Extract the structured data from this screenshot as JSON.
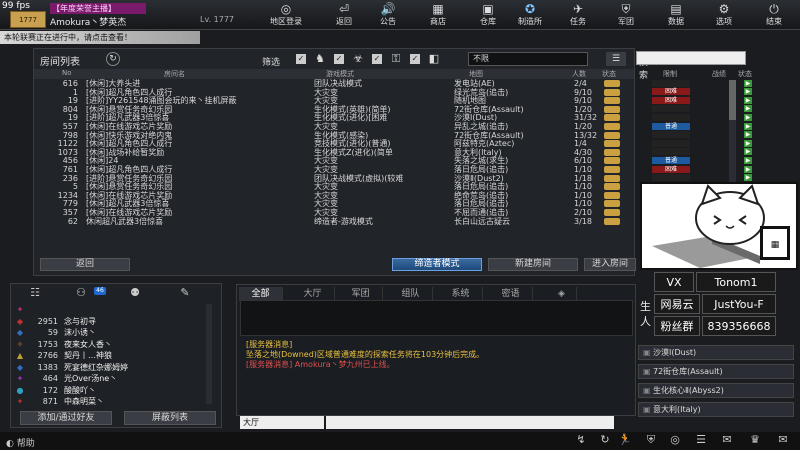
{
  "fps": "99 fps",
  "player": {
    "title_badge": "【年度荣誉主播】",
    "name": "Amokura丶梦英杰",
    "level": "Lv. 1777",
    "logo_text": "1777"
  },
  "nav": [
    {
      "label": "地区登录",
      "icon": "globe-icon",
      "glyph": "◎"
    },
    {
      "label": "返回",
      "icon": "back-icon",
      "glyph": "⏎"
    },
    {
      "label": "公告",
      "icon": "announcement-icon",
      "glyph": "🔊"
    },
    {
      "label": "商店",
      "icon": "shop-icon",
      "glyph": "▦"
    },
    {
      "label": "仓库",
      "icon": "warehouse-icon",
      "glyph": "▣"
    },
    {
      "label": "制造所",
      "icon": "factory-icon",
      "glyph": "✪"
    },
    {
      "label": "任务",
      "icon": "mission-icon",
      "glyph": "✈"
    },
    {
      "label": "军团",
      "icon": "clan-icon",
      "glyph": "⛨"
    },
    {
      "label": "数据",
      "icon": "stats-icon",
      "glyph": "▤"
    },
    {
      "label": "选项",
      "icon": "gear-icon",
      "glyph": "⚙"
    },
    {
      "label": "结束",
      "icon": "power-icon",
      "glyph": "⏻"
    }
  ],
  "banner": "本轮联赛正在进行中，请点击查看！",
  "room_list": {
    "title": "房间列表",
    "filter_label": "筛选",
    "limit_value": "不限",
    "search_label": "搜索",
    "search_value": "",
    "headers": [
      "No",
      "房间名",
      "游戏模式",
      "地图",
      "人数",
      "状态",
      "限制",
      "战绩",
      "状态"
    ],
    "rows": [
      {
        "no": "616",
        "name": "[休闲]大养头进",
        "mode": "团队决战模式",
        "map": "发电站(AE)",
        "count": "2/4",
        "rank": "",
        "rank_color": "#222"
      },
      {
        "no": "1",
        "name": "[休闲]超凡角色四人成行",
        "mode": "大灾变",
        "map": "绿光荒岛(追击)",
        "count": "9/10",
        "rank": "困难",
        "rank_color": "#8a1a1a"
      },
      {
        "no": "19",
        "name": "[进阶]YY261548涌图会玩的来丶挂机屏蔽",
        "mode": "大灾变",
        "map": "随机地图",
        "count": "9/10",
        "rank": "困难",
        "rank_color": "#8a1a1a"
      },
      {
        "no": "804",
        "name": "[休闲]悬赏任务奇幻乐园",
        "mode": "生化模式(英雄)(简单)",
        "map": "72街仓库(Assault)",
        "count": "1/20",
        "rank": "",
        "rank_color": "#222"
      },
      {
        "no": "19",
        "name": "[进阶]超凡武器3倍惊喜",
        "mode": "生化模式(进化)[困难",
        "map": "沙漠Ⅰ(Dust)",
        "count": "31/32",
        "rank": "",
        "rank_color": "#222"
      },
      {
        "no": "557",
        "name": "[休闲]在线游戏芯片奖励",
        "mode": "大灾变",
        "map": "异乱之城(追击)",
        "count": "1/20",
        "rank": "普通",
        "rank_color": "#1e5aa0"
      },
      {
        "no": "798",
        "name": "[休闲]快乐游戏对绝内鬼",
        "mode": "生化模式(感染)",
        "map": "72街仓库(Assault)",
        "count": "13/32",
        "rank": "",
        "rank_color": "#222"
      },
      {
        "no": "1122",
        "name": "[休闲]超凡角色四人成行",
        "mode": "竞技模式(进化)(普通)",
        "map": "阿兹特克(Aztec)",
        "count": "1/4",
        "rank": "",
        "rank_color": "#222"
      },
      {
        "no": "1073",
        "name": "[休闲]战场补给暂奖励",
        "mode": "生化模式Z(进化)(简单",
        "map": "意大利(Italy)",
        "count": "4/30",
        "rank": "",
        "rank_color": "#222"
      },
      {
        "no": "456",
        "name": "[休闲]24",
        "mode": "大灾变",
        "map": "失落之城(求生)",
        "count": "6/10",
        "rank": "普通",
        "rank_color": "#1e5aa0"
      },
      {
        "no": "761",
        "name": "[休闲]超凡角色四人成行",
        "mode": "大灾变",
        "map": "落日危局(追击)",
        "count": "1/10",
        "rank": "困难",
        "rank_color": "#8a1a1a"
      },
      {
        "no": "236",
        "name": "[进阶]悬赏任务奇幻乐园",
        "mode": "团队决战模式(虚拟)(较难",
        "map": "沙漠Ⅱ(Dust2)",
        "count": "1/18",
        "rank": "",
        "rank_color": "#222"
      },
      {
        "no": "5",
        "name": "[休闲]悬赏任务奇幻乐园",
        "mode": "大灾变",
        "map": "落日危局(追击)",
        "count": "1/10",
        "rank": "普通",
        "rank_color": "#1e5aa0"
      },
      {
        "no": "1234",
        "name": "[休闲]在线游戏芯片奖励",
        "mode": "大灾变",
        "map": "绝命荒岛(追击)",
        "count": "1/10",
        "rank": "普通",
        "rank_color": "#1e5aa0"
      },
      {
        "no": "779",
        "name": "[休闲]超凡武器3倍惊喜",
        "mode": "大灾变",
        "map": "落日危局(追击)",
        "count": "1/10",
        "rank": "普通",
        "rank_color": "#1e5aa0"
      },
      {
        "no": "357",
        "name": "[休闲]在线游戏芯片奖励",
        "mode": "大灾变",
        "map": "不屈而通(追击)",
        "count": "2/10",
        "rank": "普通",
        "rank_color": "#1e5aa0"
      },
      {
        "no": "62",
        "name": "休闲超凡武器3倍惊喜",
        "mode": "缔造者-游戏模式",
        "map": "长白山远古疑云",
        "count": "3/18",
        "rank": "",
        "rank_color": "#222"
      }
    ],
    "back_label": "返回",
    "mode_label": "缔造者模式",
    "create_label": "新建房间",
    "enter_label": "进入房间"
  },
  "friends": {
    "badge": "46",
    "rows": [
      {
        "level": "",
        "name": "",
        "icon_color": "#c03080",
        "glyph": "✦"
      },
      {
        "level": "2951",
        "name": "念与初寻",
        "icon_color": "#c03030",
        "glyph": "◆"
      },
      {
        "level": "59",
        "name": "沫小诱丶",
        "icon_color": "#3070c0",
        "glyph": "◆"
      },
      {
        "level": "1753",
        "name": "夜来女人香丶",
        "icon_color": "#c08030",
        "glyph": "✧"
      },
      {
        "level": "2766",
        "name": "契丹丨…神狼",
        "icon_color": "#c0a030",
        "glyph": "▲"
      },
      {
        "level": "1383",
        "name": "死宴德红杂娜姆婷",
        "icon_color": "#3070c0",
        "glyph": "◆"
      },
      {
        "level": "464",
        "name": "光Over汤ne丶",
        "icon_color": "#a030c0",
        "glyph": "✦"
      },
      {
        "level": "172",
        "name": "酸酸吖丶",
        "icon_color": "#30a0c0",
        "glyph": "●"
      },
      {
        "level": "871",
        "name": "中森明菜丶",
        "icon_color": "#c03030",
        "glyph": "✦"
      }
    ],
    "add_label": "添加/通过好友",
    "block_label": "屏蔽列表"
  },
  "chat": {
    "tabs": [
      "全部",
      "大厅",
      "军团",
      "组队",
      "系统",
      "密语"
    ],
    "messages": [
      {
        "text": "[服务器消息]",
        "color": "#e8c040"
      },
      {
        "text": "坠落之地(Downed)区域普通难度的探索任务将在103分钟后完成。",
        "color": "#e8c040"
      },
      {
        "text": "[服务器消息] Amokura丶梦九州已上线。",
        "color": "#e05050"
      }
    ],
    "channel": "大厅",
    "input_value": ""
  },
  "overlay": {
    "vx_label": "VX",
    "vx_value": "Tonom1",
    "netease_label": "网易云",
    "netease_value": "JustYou-F",
    "fans_label": "粉丝群",
    "fans_value": "839356668",
    "side_text_1": "生",
    "side_text_2": "人"
  },
  "maps": [
    {
      "label": "沙漠Ⅰ(Dust)"
    },
    {
      "label": "72街仓库(Assault)"
    },
    {
      "label": "生化核心Ⅱ(Abyss2)"
    },
    {
      "label": "意大利(Italy)"
    }
  ],
  "bottom": {
    "help_label": "帮助"
  }
}
